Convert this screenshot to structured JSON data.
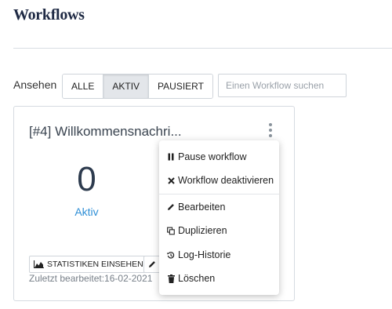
{
  "page": {
    "title": "Workflows"
  },
  "filter": {
    "label": "Ansehen",
    "options": [
      "ALLE",
      "AKTIV",
      "PAUSIERT"
    ],
    "selected": "AKTIV"
  },
  "search": {
    "placeholder": "Einen Workflow suchen",
    "value": ""
  },
  "card": {
    "title": "[#4] Willkommensnachri...",
    "metric_value": "0",
    "metric_label": "Aktiv",
    "stats_button": "STATISTIKEN EINSEHEN",
    "last_edited": "Zuletzt bearbeitet:16-02-2021"
  },
  "menu": {
    "group1": [
      {
        "label": "Pause workflow",
        "icon": "pause-icon"
      },
      {
        "label": "Workflow deaktivieren",
        "icon": "times-icon"
      }
    ],
    "group2": [
      {
        "label": "Bearbeiten",
        "icon": "pencil-icon"
      },
      {
        "label": "Duplizieren",
        "icon": "copy-icon"
      },
      {
        "label": "Log-Historie",
        "icon": "history-icon"
      },
      {
        "label": "Löschen",
        "icon": "trash-icon"
      }
    ]
  },
  "colors": {
    "accent": "#2f8fd6",
    "title": "#1f2a44"
  }
}
